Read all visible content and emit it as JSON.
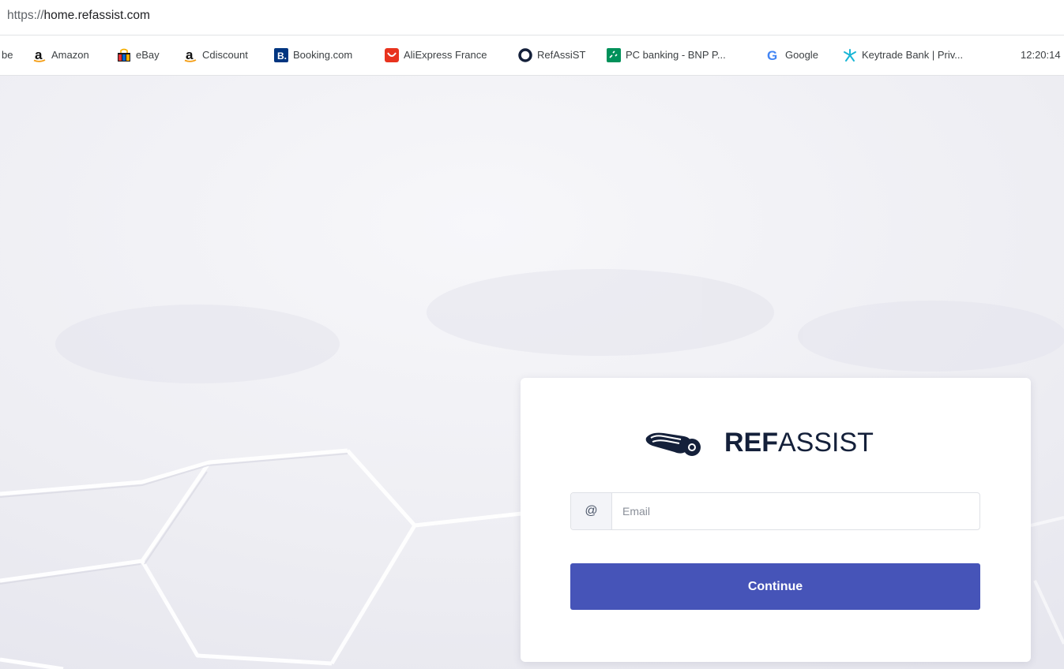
{
  "browser": {
    "url_scheme": "https://",
    "url_host": "home.refassist.com",
    "bookmarks_cut_label": "be",
    "bookmarks": [
      {
        "label": "Amazon",
        "icon": "amazon-icon"
      },
      {
        "label": "eBay",
        "icon": "ebay-icon"
      },
      {
        "label": "Cdiscount",
        "icon": "amazon-icon"
      },
      {
        "label": "Booking.com",
        "icon": "booking-icon"
      },
      {
        "label": "AliExpress France",
        "icon": "aliexpress-icon"
      },
      {
        "label": "RefAssiST",
        "icon": "refassist-icon"
      },
      {
        "label": "PC banking - BNP P...",
        "icon": "bnp-icon"
      },
      {
        "label": "Google",
        "icon": "google-icon"
      },
      {
        "label": "Keytrade Bank | Priv...",
        "icon": "keytrade-icon"
      }
    ],
    "clock": "12:20:14"
  },
  "login": {
    "brand_bold": "REF",
    "brand_regular": "ASSIST",
    "email_addon": "@",
    "email_placeholder": "Email",
    "email_value": "",
    "continue_label": "Continue"
  },
  "colors": {
    "primary_button": "#4654b8",
    "brand_text": "#14203a",
    "background": "#f3f4f6"
  }
}
